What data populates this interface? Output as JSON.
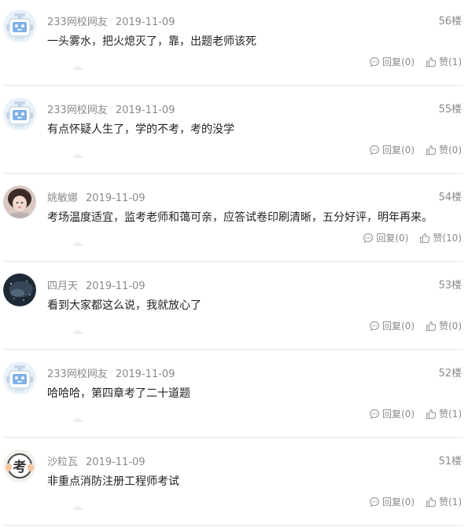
{
  "comments": [
    {
      "user": "233网校网友",
      "date": "2019-11-09",
      "floor": "56楼",
      "text": "一头雾水，把火熄灭了，靠，出题老师该死",
      "reply": "回复(0)",
      "like": "赞(1)",
      "avatar": "robot-avatar"
    },
    {
      "user": "233网校网友",
      "date": "2019-11-09",
      "floor": "55楼",
      "text": "有点怀疑人生了，学的不考，考的没学",
      "reply": "回复(0)",
      "like": "赞(0)",
      "avatar": "robot-avatar"
    },
    {
      "user": "姚敏娜",
      "date": "2019-11-09",
      "floor": "54楼",
      "text": "考场温度适宜，监考老师和蔼可亲，应答试卷印刷清晰，五分好评，明年再来。",
      "reply": "回复(0)",
      "like": "赞(10)",
      "avatar": "photo-avatar"
    },
    {
      "user": "四月天",
      "date": "2019-11-09",
      "floor": "53楼",
      "text": "看到大家都这么说，我就放心了",
      "reply": "回复(0)",
      "like": "赞(0)",
      "avatar": "space-avatar"
    },
    {
      "user": "233网校网友",
      "date": "2019-11-09",
      "floor": "52楼",
      "text": "哈哈哈，第四章考了二十道题",
      "reply": "回复(0)",
      "like": "赞(1)",
      "avatar": "robot-avatar"
    },
    {
      "user": "沙粒瓦",
      "date": "2019-11-09",
      "floor": "51楼",
      "text": "非重点消防注册工程师考试",
      "reply": "回复(0)",
      "like": "赞(1)",
      "avatar": "kao-avatar",
      "avatar_char": "考"
    }
  ],
  "colors": {
    "meta": "#8a8a8a",
    "text": "#222222",
    "divider": "#e6e6e6",
    "robot": "#c6dcf5"
  }
}
